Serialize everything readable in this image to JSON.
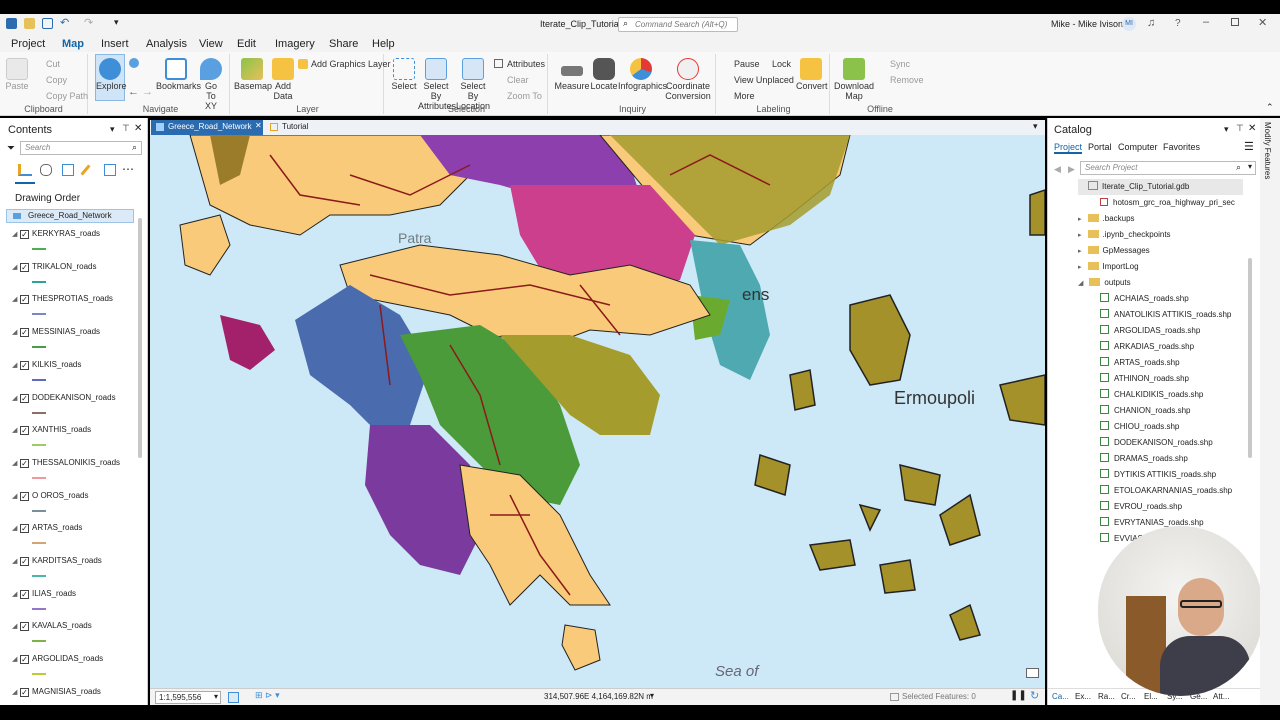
{
  "window": {
    "title": "Iterate_Clip_Tutorial",
    "search_placeholder": "Command Search (Alt+Q)",
    "user": "Mike - Mike Ivison",
    "user_initials": "MI"
  },
  "menu": [
    "Project",
    "Map",
    "Insert",
    "Analysis",
    "View",
    "Edit",
    "Imagery",
    "Share",
    "Help"
  ],
  "ribbon": {
    "clipboard": {
      "label": "Clipboard",
      "paste": "Paste",
      "cut": "Cut",
      "copy": "Copy",
      "copy_path": "Copy Path"
    },
    "navigate": {
      "label": "Navigate",
      "explore": "Explore",
      "bookmarks": "Bookmarks",
      "go_to_xy": "Go To XY"
    },
    "layer": {
      "label": "Layer",
      "basemap": "Basemap",
      "add_data": "Add Data",
      "add_graphics": "Add Graphics Layer"
    },
    "selection": {
      "label": "Selection",
      "select": "Select",
      "select_by_attributes": "Select By Attributes",
      "select_by_location": "Select By Location",
      "attributes": "Attributes",
      "clear": "Clear",
      "zoom_to": "Zoom To"
    },
    "inquiry": {
      "label": "Inquiry",
      "measure": "Measure",
      "locate": "Locate",
      "infographics": "Infographics",
      "coordinate_conversion": "Coordinate Conversion"
    },
    "labeling": {
      "label": "Labeling",
      "pause": "Pause",
      "lock": "Lock",
      "view_unplaced": "View Unplaced",
      "more": "More",
      "convert": "Convert"
    },
    "offline": {
      "label": "Offline",
      "download_map": "Download Map",
      "sync": "Sync",
      "remove": "Remove"
    }
  },
  "contents": {
    "title": "Contents",
    "search_placeholder": "Search",
    "drawing_order": "Drawing Order",
    "map_name": "Greece_Road_Network",
    "layers": [
      {
        "name": "KERKYRAS_roads",
        "color": "#4caf50"
      },
      {
        "name": "TRIKALON_roads",
        "color": "#26a69a"
      },
      {
        "name": "THESPROTIAS_roads",
        "color": "#7986cb"
      },
      {
        "name": "MESSINIAS_roads",
        "color": "#43a047"
      },
      {
        "name": "KILKIS_roads",
        "color": "#5c6bc0"
      },
      {
        "name": "DODEKANISON_roads",
        "color": "#8d6e63"
      },
      {
        "name": "XANTHIS_roads",
        "color": "#9ccc65"
      },
      {
        "name": "THESSALONIKIS_roads",
        "color": "#ef9a9a"
      },
      {
        "name": "O OROS_roads",
        "color": "#78909c"
      },
      {
        "name": "ARTAS_roads",
        "color": "#d4a574"
      },
      {
        "name": "KARDITSAS_roads",
        "color": "#4db6ac"
      },
      {
        "name": "ILIAS_roads",
        "color": "#9575cd"
      },
      {
        "name": "KAVALAS_roads",
        "color": "#7cb342"
      },
      {
        "name": "ARGOLIDAS_roads",
        "color": "#c0ca33"
      },
      {
        "name": "MAGNISIAS_roads",
        "color": "#5c6bc0"
      }
    ]
  },
  "map": {
    "tabs": [
      "Greece_Road_Network",
      "Tutorial"
    ],
    "labels": {
      "patra": "Patra",
      "athens": "ens",
      "ermoupoli": "Ermoupoli",
      "sea": "Sea of"
    },
    "scale": "1:1,595,556",
    "coords": "314,507.96E 4,164,169.82N m",
    "selected_features": "Selected Features: 0"
  },
  "catalog": {
    "title": "Catalog",
    "tabs": [
      "Project",
      "Portal",
      "Computer",
      "Favorites"
    ],
    "search_placeholder": "Search Project",
    "gdb": "Iterate_Clip_Tutorial.gdb",
    "gdb_child": "hotosm_grc_roa_highway_pri_sec",
    "folders": [
      ".backups",
      ".ipynb_checkpoints",
      "GpMessages",
      "ImportLog",
      "outputs"
    ],
    "outputs": [
      "ACHAIAS_roads.shp",
      "ANATOLIKIS ATTIKIS_roads.shp",
      "ARGOLIDAS_roads.shp",
      "ARKADIAS_roads.shp",
      "ARTAS_roads.shp",
      "ATHINON_roads.shp",
      "CHALKIDIKIS_roads.shp",
      "CHANION_roads.shp",
      "CHIOU_roads.shp",
      "DODEKANISON_roads.shp",
      "DRAMAS_roads.shp",
      "DYTIKIS ATTIKIS_roads.shp",
      "ETOLOAKARNANIAS_roads.shp",
      "EVROU_roads.shp",
      "EVRYTANIAS_roads.shp",
      "EVVIAS"
    ],
    "bottom_tabs": [
      "Ca...",
      "Ex...",
      "Ra...",
      "Cr...",
      "El...",
      "Sy...",
      "Ge...",
      "Att..."
    ]
  },
  "side": {
    "modify_features": "Modify Features"
  }
}
